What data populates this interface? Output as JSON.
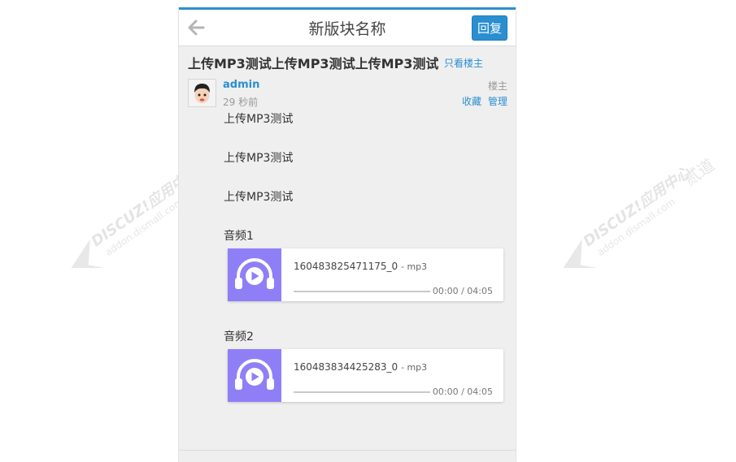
{
  "header": {
    "back_icon": "arrow-left-icon",
    "title": "新版块名称",
    "reply_label": "回复"
  },
  "thread": {
    "title": "上传MP3测试上传MP3测试上传MP3测试",
    "only_op_label": "只看楼主"
  },
  "post": {
    "author": "admin",
    "time": "29 秒前",
    "badge": "楼主",
    "favorite_label": "收藏",
    "manage_label": "管理",
    "paragraphs": [
      "上传MP3测试",
      "上传MP3测试",
      "上传MP3测试"
    ]
  },
  "audios": [
    {
      "label": "音频1",
      "filename": "160483825471175_0",
      "ext": "- mp3",
      "time": "00:00 / 04:05",
      "progress": 0
    },
    {
      "label": "音频2",
      "filename": "160483834425283_0",
      "ext": "- mp3",
      "time": "00:00 / 04:05",
      "progress": 0
    }
  ],
  "watermark": {
    "brand": "DISCUZ!应用中心",
    "domain": "addon.dismall.com",
    "mark": "贰道",
    "color": "#c9c9c9"
  },
  "colors": {
    "accent": "#2a8fd1",
    "audio_cover": "#8f7ff7",
    "page_bg": "#efefef"
  }
}
